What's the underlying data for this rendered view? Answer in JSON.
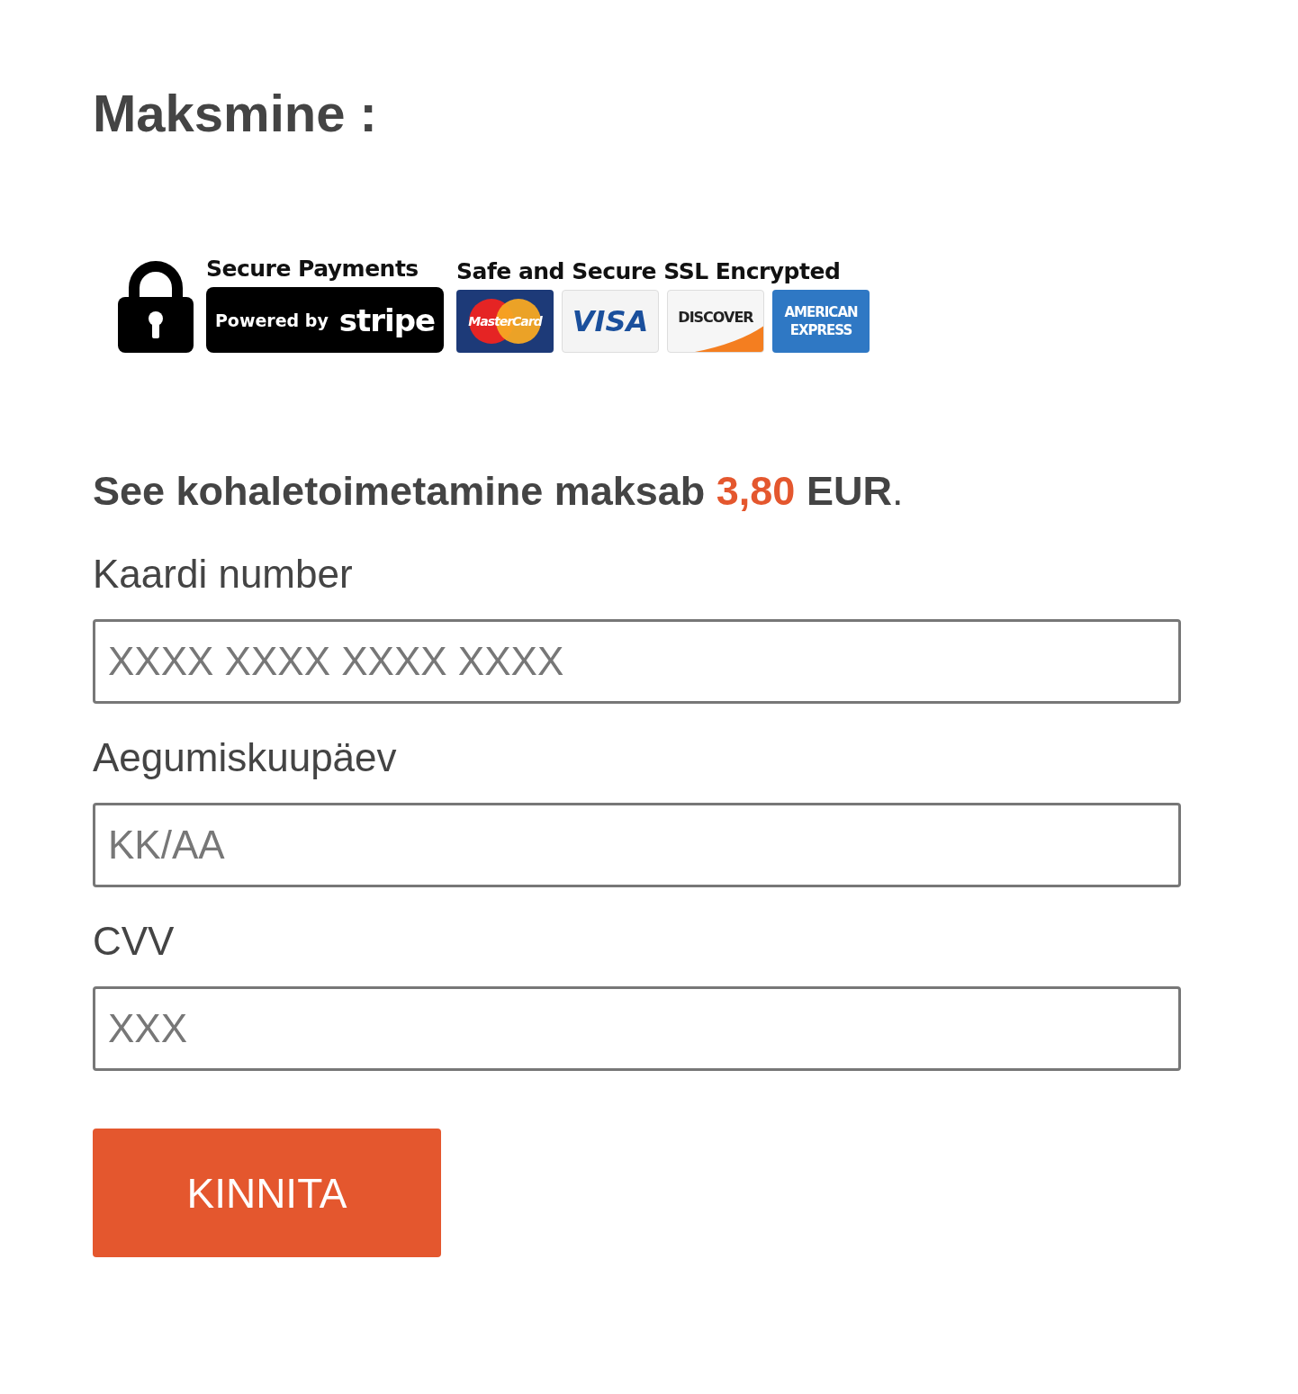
{
  "heading": "Maksmine :",
  "badge": {
    "secure_title": "Secure Payments",
    "powered": "Powered by",
    "brand": "stripe",
    "ssl_title": "Safe and Secure SSL Encrypted",
    "cards": [
      {
        "kind": "mastercard",
        "label": "MasterCard"
      },
      {
        "kind": "visa",
        "label": "VISA"
      },
      {
        "kind": "discover",
        "label": "DISCOVER"
      },
      {
        "kind": "amex",
        "label": "AMERICAN EXPRESS"
      }
    ]
  },
  "summary": {
    "text": "See kohaletoimetamine maksab",
    "amount": "3,80",
    "currency": "EUR",
    "end": "."
  },
  "fields": [
    {
      "label": "Kaardi number",
      "placeholder": "XXXX XXXX XXXX XXXX"
    },
    {
      "label": "Aegumiskuupäev",
      "placeholder": "KK/AA"
    },
    {
      "label": "CVV",
      "placeholder": "XXX"
    }
  ],
  "button": "KINNITA"
}
